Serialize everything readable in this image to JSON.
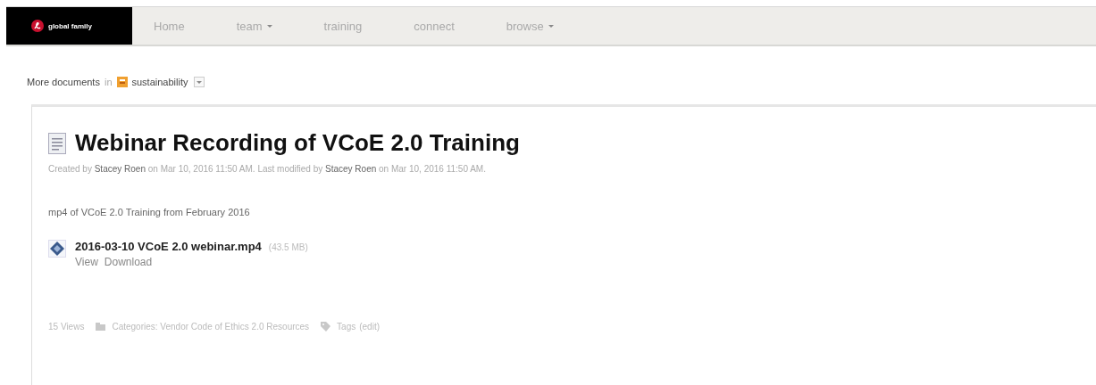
{
  "logo": {
    "text": "global family"
  },
  "nav": [
    {
      "label": "Home",
      "has_menu": false
    },
    {
      "label": "team",
      "has_menu": true
    },
    {
      "label": "training",
      "has_menu": false
    },
    {
      "label": "connect",
      "has_menu": false
    },
    {
      "label": "browse",
      "has_menu": true
    }
  ],
  "breadcrumb": {
    "prefix": "More documents",
    "in": "in",
    "space": "sustainability"
  },
  "document": {
    "title": "Webinar Recording of VCoE 2.0 Training",
    "meta": "Created by **Stacey Roen** on Mar 10, 2016 11:50 AM. Last modified by **Stacey Roen** on Mar 10, 2016 11:50 AM.",
    "description": "mp4 of VCoE 2.0 Training from February 2016",
    "attachment": {
      "name": "2016-03-10 VCoE 2.0 webinar.mp4",
      "size": "(43.5 MB)",
      "actions": [
        "View",
        "Download"
      ]
    },
    "footer": {
      "views": "15 Views",
      "categories": "Categories: Vendor Code of Ethics 2.0 Resources",
      "tags": "Tags",
      "edit": "(edit)"
    }
  }
}
